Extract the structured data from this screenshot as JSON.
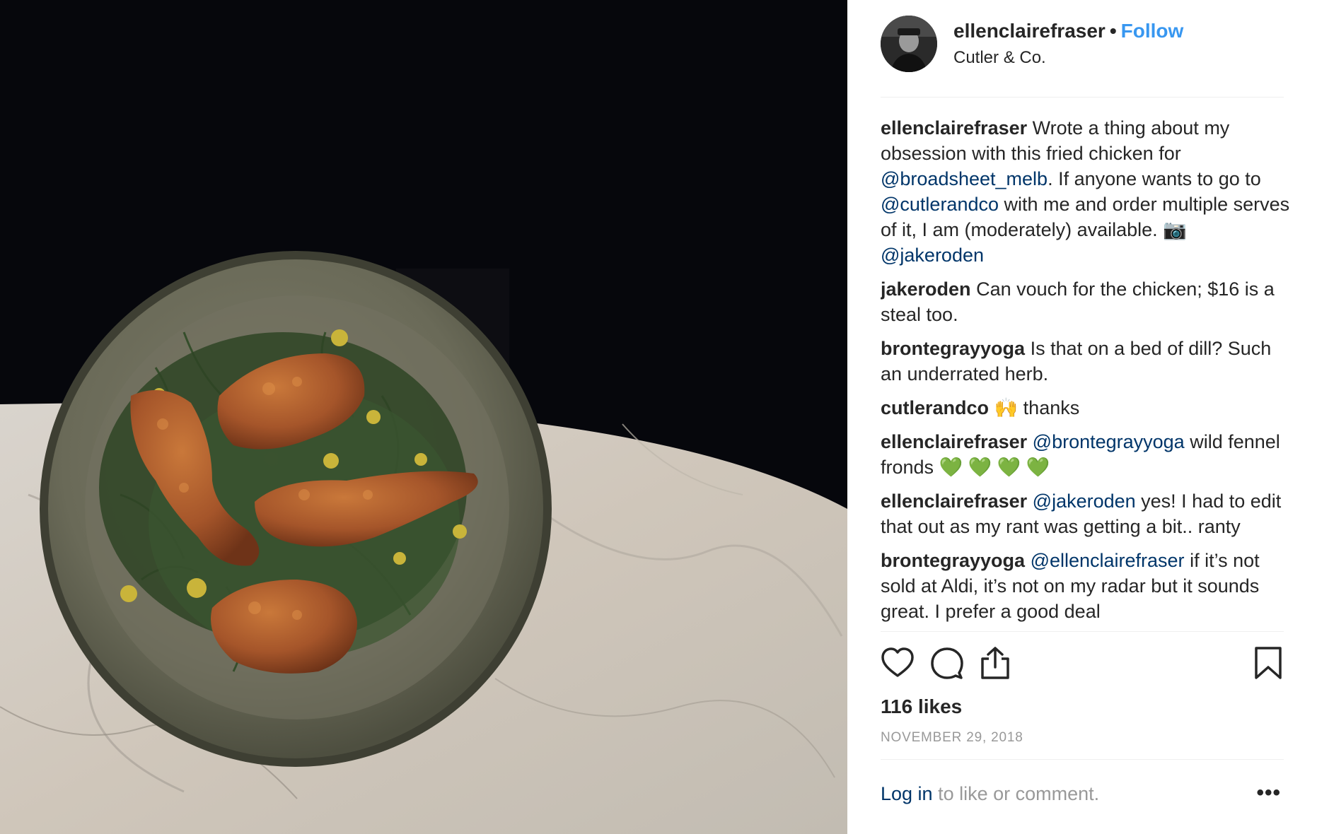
{
  "post": {
    "author": "ellenclairefraser",
    "separator": "•",
    "follow_label": "Follow",
    "location": "Cutler & Co."
  },
  "caption": {
    "user": "ellenclairefraser",
    "t1": "Wrote a thing about my obsession with this fried chicken for ",
    "m1": "@broadsheet_melb",
    "t2": ". If anyone wants to go to ",
    "m2": "@cutlerandco",
    "t3": " with me and order multiple serves of it, I am (moderately) available. 📷 ",
    "m3": "@jakeroden"
  },
  "comments": [
    {
      "user": "jakeroden",
      "mention": "",
      "text": "Can vouch for the chicken; $16 is a steal too."
    },
    {
      "user": "brontegrayyoga",
      "mention": "",
      "text": "Is that on a bed of dill? Such an underrated herb."
    },
    {
      "user": "cutlerandco",
      "mention": "",
      "text": "🙌  thanks"
    },
    {
      "user": "ellenclairefraser",
      "mention": "@brontegrayyoga",
      "text": " wild fennel fronds 💚 💚 💚 💚"
    },
    {
      "user": "ellenclairefraser",
      "mention": "@jakeroden",
      "text": " yes! I had to edit that out as my rant was getting a bit.. ranty"
    },
    {
      "user": "brontegrayyoga",
      "mention": "@ellenclairefraser",
      "text": " if it’s not sold at Aldi, it’s not on my radar but it sounds great. I prefer a good deal"
    }
  ],
  "actions": {
    "like_icon": "heart-icon",
    "comment_icon": "comment-icon",
    "share_icon": "share-icon",
    "save_icon": "bookmark-icon"
  },
  "likes": "116 likes",
  "date": "NOVEMBER 29, 2018",
  "login": {
    "link": "Log in",
    "text": " to like or comment.",
    "more": "•••"
  }
}
